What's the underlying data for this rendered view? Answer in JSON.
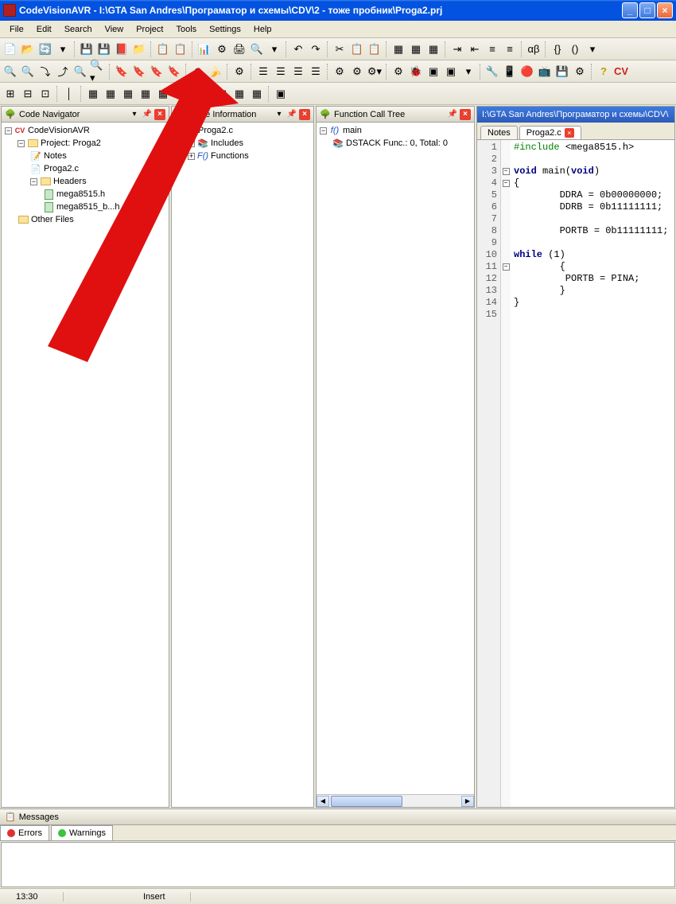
{
  "titlebar": {
    "title": "CodeVisionAVR - I:\\GTA San Andres\\Програматор и схемы\\CDV\\2 - тоже пробник\\Proga2.prj"
  },
  "menubar": {
    "items": [
      "File",
      "Edit",
      "Search",
      "View",
      "Project",
      "Tools",
      "Settings",
      "Help"
    ]
  },
  "panels": {
    "navigator": {
      "title": "Code Navigator",
      "root": "CodeVisionAVR",
      "project": "Project: Proga2",
      "notes": "Notes",
      "source": "Proga2.c",
      "headers": "Headers",
      "header1": "mega8515.h",
      "header2": "mega8515_b...h",
      "other": "Other Files"
    },
    "codeinfo": {
      "title": "Code Information",
      "file": "Proga2.c",
      "includes": "Includes",
      "functions": "Functions"
    },
    "calltree": {
      "title": "Function Call Tree",
      "main": "main",
      "dstack": "DSTACK Func.: 0, Total: 0"
    }
  },
  "editor": {
    "path": "I:\\GTA San Andres\\Програматор и схемы\\CDV\\",
    "tab_notes": "Notes",
    "tab_file": "Proga2.c",
    "code": {
      "l1_pre": "#include ",
      "l1_inc": "<mega8515.h>",
      "l3_a": "void",
      "l3_b": " main(",
      "l3_c": "void",
      "l3_d": ")",
      "l4": "{",
      "l5": "        DDRA = 0b00000000;",
      "l6": "        DDRB = 0b11111111;",
      "l8": "        PORTB = 0b11111111;",
      "l10_a": "while",
      "l10_b": " (1)",
      "l11": "        {",
      "l12": "         PORTB = PINA;",
      "l13": "        }",
      "l14": "}"
    }
  },
  "messages": {
    "title": "Messages",
    "tab_errors": "Errors",
    "tab_warnings": "Warnings"
  },
  "status": {
    "time": "13:30",
    "mode": "Insert"
  }
}
